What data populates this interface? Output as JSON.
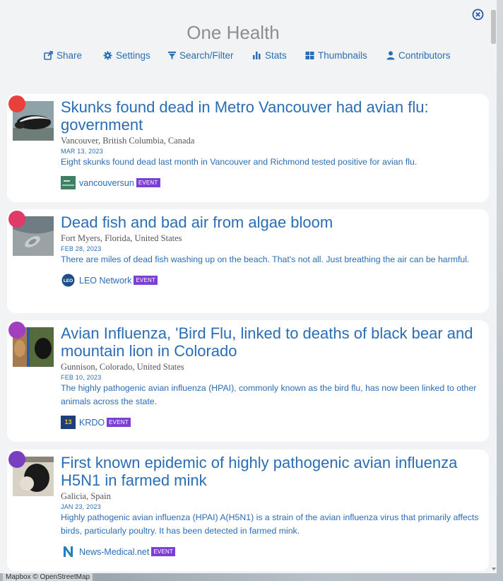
{
  "app": {
    "title": "One Health"
  },
  "toolbar": {
    "items": [
      {
        "label": "Share",
        "icon": "share-icon"
      },
      {
        "label": "Settings",
        "icon": "gear-icon"
      },
      {
        "label": "Search/Filter",
        "icon": "filter-icon"
      },
      {
        "label": "Stats",
        "icon": "bar-chart-icon"
      },
      {
        "label": "Thumbnails",
        "icon": "grid-icon"
      },
      {
        "label": "Contributors",
        "icon": "user-icon"
      }
    ]
  },
  "attribution": "Mapbox © OpenStreetMap",
  "cards": [
    {
      "dot_color": "#e8413c",
      "headline": "Skunks found dead in Metro Vancouver had avian flu: government",
      "location": "Vancouver, British Columbia, Canada",
      "date": "MAR 13, 2023",
      "summary": "Eight skunks found dead last month in Vancouver and Richmond tested positive for avian flu.",
      "source": "vancouversun",
      "badge": "EVENT"
    },
    {
      "dot_color": "#e03a68",
      "headline": "Dead fish and bad air from algae bloom",
      "location": "Fort Myers, Florida, United States",
      "date": "FEB 28, 2023",
      "summary": "There are miles of dead fish washing up on the beach. That's not all. Just breathing the air can be harmful.",
      "source": "LEO Network",
      "badge": "EVENT"
    },
    {
      "dot_color": "#a23fbf",
      "headline": "Avian Influenza, 'Bird Flu, linked to deaths of black bear and mountain lion in Colorado",
      "location": "Gunnison, Colorado, United States",
      "date": "FEB 10, 2023",
      "summary": "The highly pathogenic avian influenza (HPAI), commonly known as the bird flu, has now been linked to other animals across the state.",
      "source": "KRDO",
      "badge": "EVENT"
    },
    {
      "dot_color": "#7a3fbf",
      "headline": "First known epidemic of highly pathogenic avian influenza H5N1 in farmed mink",
      "location": "Galicia, Spain",
      "date": "JAN 23, 2023",
      "summary": "Highly pathogenic avian influenza (HPAI) A(H5N1) is a strain of the avian influenza virus that primarily affects birds, particularly poultry. It has been detected in farmed mink.",
      "source": "News-Medical.net",
      "badge": "EVENT"
    }
  ]
}
